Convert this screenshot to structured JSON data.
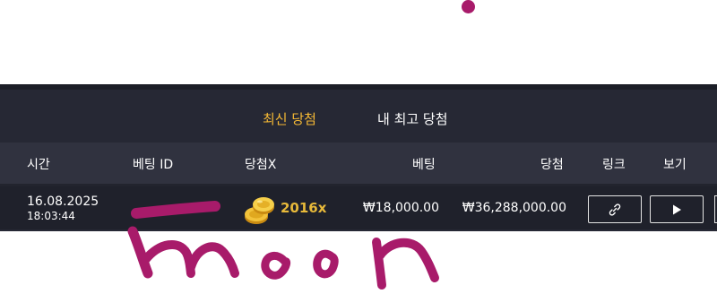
{
  "tabs": [
    {
      "label": "최신 당첨",
      "active": true
    },
    {
      "label": "내 최고 당첨",
      "active": false
    }
  ],
  "columns": {
    "time": "시간",
    "bet_id": "베팅 ID",
    "multiplier": "당첨X",
    "bet": "베팅",
    "win": "당첨",
    "link": "링크",
    "view": "보기"
  },
  "rows": [
    {
      "date": "16.08.2025",
      "time": "18:03:44",
      "bet_id": "",
      "multiplier": "2016x",
      "bet": "₩18,000.00",
      "win": "₩36,288,000.00",
      "link_icon": "link-icon",
      "view_icon": "play-icon"
    }
  ],
  "colors": {
    "accent": "#f5b935",
    "panel": "#262834",
    "header": "#30323f",
    "row": "#1f212b",
    "scribble": "#a81b6a"
  }
}
